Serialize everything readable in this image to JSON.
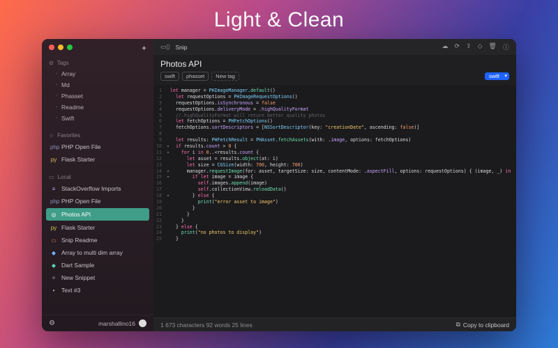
{
  "hero": "Light & Clean",
  "colors": {
    "traffic": [
      "#ff5f57",
      "#febc2e",
      "#28c840"
    ],
    "accent": "#1e63ff",
    "active": "#3f9d88"
  },
  "sidebar": {
    "plus": "+",
    "sections": {
      "tags": {
        "label": "Tags",
        "icon": "⊘",
        "items": [
          "Array",
          "Md",
          "Phasset",
          "Readme",
          "Swift"
        ]
      },
      "favorites": {
        "label": "Favorites",
        "icon": "☆",
        "items": [
          {
            "icon": "php",
            "color": "#8892BF",
            "label": "PHP Open File"
          },
          {
            "icon": "py",
            "color": "#d8c35a",
            "label": "Flask Starter"
          }
        ]
      },
      "local": {
        "label": "Local",
        "icon": "▭",
        "items": [
          {
            "icon": "≡",
            "color": "#caa6ff",
            "label": "StackOverflow Imports",
            "active": false
          },
          {
            "icon": "php",
            "color": "#8892BF",
            "label": "PHP Open File",
            "active": false
          },
          {
            "icon": "◎",
            "color": "#ffffff",
            "label": "Photos API",
            "active": true
          },
          {
            "icon": "py",
            "color": "#d8c35a",
            "label": "Flask Starter",
            "active": false
          },
          {
            "icon": "▭",
            "color": "#e27d60",
            "label": "Snip Readme",
            "active": false
          },
          {
            "icon": "◆",
            "color": "#6fb3ff",
            "label": "Array to multi dim array",
            "active": false
          },
          {
            "icon": "◆",
            "color": "#5bd1b7",
            "label": "Dart Sample",
            "active": false
          },
          {
            "icon": "✧",
            "color": "#b9b9c4",
            "label": "New Snippet",
            "active": false
          },
          {
            "icon": "•",
            "color": "#b9b9c4",
            "label": "Text #3",
            "active": false
          }
        ]
      }
    },
    "footer": {
      "settings": "⚙",
      "username": "marshallino16"
    }
  },
  "topbar": {
    "left_icon": "▭▯",
    "app": "Snip",
    "actions": [
      {
        "name": "cloud-icon",
        "glyph": "☁"
      },
      {
        "name": "sync-icon",
        "glyph": "⟳"
      },
      {
        "name": "export-icon",
        "glyph": "⇪"
      },
      {
        "name": "bookmark-icon",
        "glyph": "◇"
      },
      {
        "name": "trash-icon",
        "glyph": "🗑"
      },
      {
        "name": "info-icon",
        "glyph": "ⓘ"
      }
    ]
  },
  "snippet": {
    "title": "Photos API",
    "tags": [
      "swift",
      "phasset"
    ],
    "new_tag": "New tag",
    "language": "swift"
  },
  "code": [
    [
      [
        "k",
        "let "
      ],
      [
        "n",
        "manager = "
      ],
      [
        "t",
        "PHImageManager"
      ],
      [
        "n",
        "."
      ],
      [
        "f",
        "default"
      ],
      [
        "n",
        "()"
      ]
    ],
    [
      [
        "n",
        "  "
      ],
      [
        "k",
        "let "
      ],
      [
        "n",
        "requestOptions = "
      ],
      [
        "t",
        "PHImageRequestOptions"
      ],
      [
        "n",
        "()"
      ]
    ],
    [
      [
        "n",
        "  requestOptions."
      ],
      [
        "p",
        "isSynchronous"
      ],
      [
        "n",
        " = "
      ],
      [
        "b",
        "false"
      ]
    ],
    [
      [
        "n",
        "  requestOptions."
      ],
      [
        "p",
        "deliveryMode"
      ],
      [
        "n",
        " = ."
      ],
      [
        "p",
        "highQualityFormat"
      ]
    ],
    [
      [
        "c",
        "  //.highQualityFormat will return better quality photos"
      ]
    ],
    [
      [
        "n",
        "  "
      ],
      [
        "k",
        "let "
      ],
      [
        "n",
        "fetchOptions = "
      ],
      [
        "t",
        "PHFetchOptions"
      ],
      [
        "n",
        "()"
      ]
    ],
    [
      [
        "n",
        "  fetchOptions."
      ],
      [
        "p",
        "sortDescriptors"
      ],
      [
        "n",
        " = ["
      ],
      [
        "t",
        "NSSortDescriptor"
      ],
      [
        "n",
        "(key: "
      ],
      [
        "s",
        "\"creationDate\""
      ],
      [
        "n",
        ", ascending: "
      ],
      [
        "b",
        "false"
      ],
      [
        "n",
        ")]"
      ]
    ],
    [
      [
        "n",
        " "
      ]
    ],
    [
      [
        "n",
        "  "
      ],
      [
        "k",
        "let "
      ],
      [
        "n",
        "results: "
      ],
      [
        "t",
        "PHFetchResult"
      ],
      [
        "n",
        " = "
      ],
      [
        "t",
        "PHAsset"
      ],
      [
        "n",
        "."
      ],
      [
        "f",
        "fetchAssets"
      ],
      [
        "n",
        "(with: ."
      ],
      [
        "p",
        "image"
      ],
      [
        "n",
        ", options: fetchOptions)"
      ]
    ],
    [
      [
        "n",
        "  "
      ],
      [
        "k",
        "if"
      ],
      [
        "n",
        " results."
      ],
      [
        "p",
        "count"
      ],
      [
        "n",
        " > "
      ],
      [
        "b",
        "0"
      ],
      [
        "n",
        " {"
      ]
    ],
    [
      [
        "n",
        "    "
      ],
      [
        "k",
        "for"
      ],
      [
        "n",
        " i "
      ],
      [
        "k",
        "in"
      ],
      [
        "n",
        " "
      ],
      [
        "b",
        "0"
      ],
      [
        "n",
        "..<results."
      ],
      [
        "p",
        "count"
      ],
      [
        "n",
        " {"
      ]
    ],
    [
      [
        "n",
        "      "
      ],
      [
        "k",
        "let "
      ],
      [
        "n",
        "asset = results."
      ],
      [
        "f",
        "object"
      ],
      [
        "n",
        "(at: i)"
      ]
    ],
    [
      [
        "n",
        "      "
      ],
      [
        "k",
        "let "
      ],
      [
        "n",
        "size = "
      ],
      [
        "t",
        "CGSize"
      ],
      [
        "n",
        "(width: "
      ],
      [
        "b",
        "700"
      ],
      [
        "n",
        ", height: "
      ],
      [
        "b",
        "700"
      ],
      [
        "n",
        ")"
      ]
    ],
    [
      [
        "n",
        "      manager."
      ],
      [
        "f",
        "requestImage"
      ],
      [
        "n",
        "(for: asset, targetSize: size, contentMode: ."
      ],
      [
        "p",
        "aspectFill"
      ],
      [
        "n",
        ", options: requestOptions) { (image, _) "
      ],
      [
        "k",
        "in"
      ]
    ],
    [
      [
        "n",
        "        "
      ],
      [
        "k",
        "if let"
      ],
      [
        "n",
        " image = image {"
      ]
    ],
    [
      [
        "n",
        "          "
      ],
      [
        "k",
        "self"
      ],
      [
        "n",
        ".images."
      ],
      [
        "f",
        "append"
      ],
      [
        "n",
        "(image)"
      ]
    ],
    [
      [
        "n",
        "          "
      ],
      [
        "k",
        "self"
      ],
      [
        "n",
        ".collectionView."
      ],
      [
        "f",
        "reloadData"
      ],
      [
        "n",
        "()"
      ]
    ],
    [
      [
        "n",
        "        } "
      ],
      [
        "k",
        "else"
      ],
      [
        "n",
        " {"
      ]
    ],
    [
      [
        "n",
        "          "
      ],
      [
        "f",
        "print"
      ],
      [
        "n",
        "("
      ],
      [
        "s",
        "\"error asset to image\""
      ],
      [
        "n",
        ")"
      ]
    ],
    [
      [
        "n",
        "        }"
      ]
    ],
    [
      [
        "n",
        "      }"
      ]
    ],
    [
      [
        "n",
        "    }"
      ]
    ],
    [
      [
        "n",
        "  } "
      ],
      [
        "k",
        "else"
      ],
      [
        "n",
        " {"
      ]
    ],
    [
      [
        "n",
        "    "
      ],
      [
        "f",
        "print"
      ],
      [
        "n",
        "("
      ],
      [
        "s",
        "\"no photos to display\""
      ],
      [
        "n",
        ")"
      ]
    ],
    [
      [
        "n",
        "  }"
      ]
    ]
  ],
  "fold_lines": [
    10,
    11,
    14,
    15,
    18
  ],
  "statusbar": {
    "stats": "1 673 characters 92 words 25 lines",
    "copy_label": "Copy to clipboard",
    "copy_icon": "⧉"
  }
}
